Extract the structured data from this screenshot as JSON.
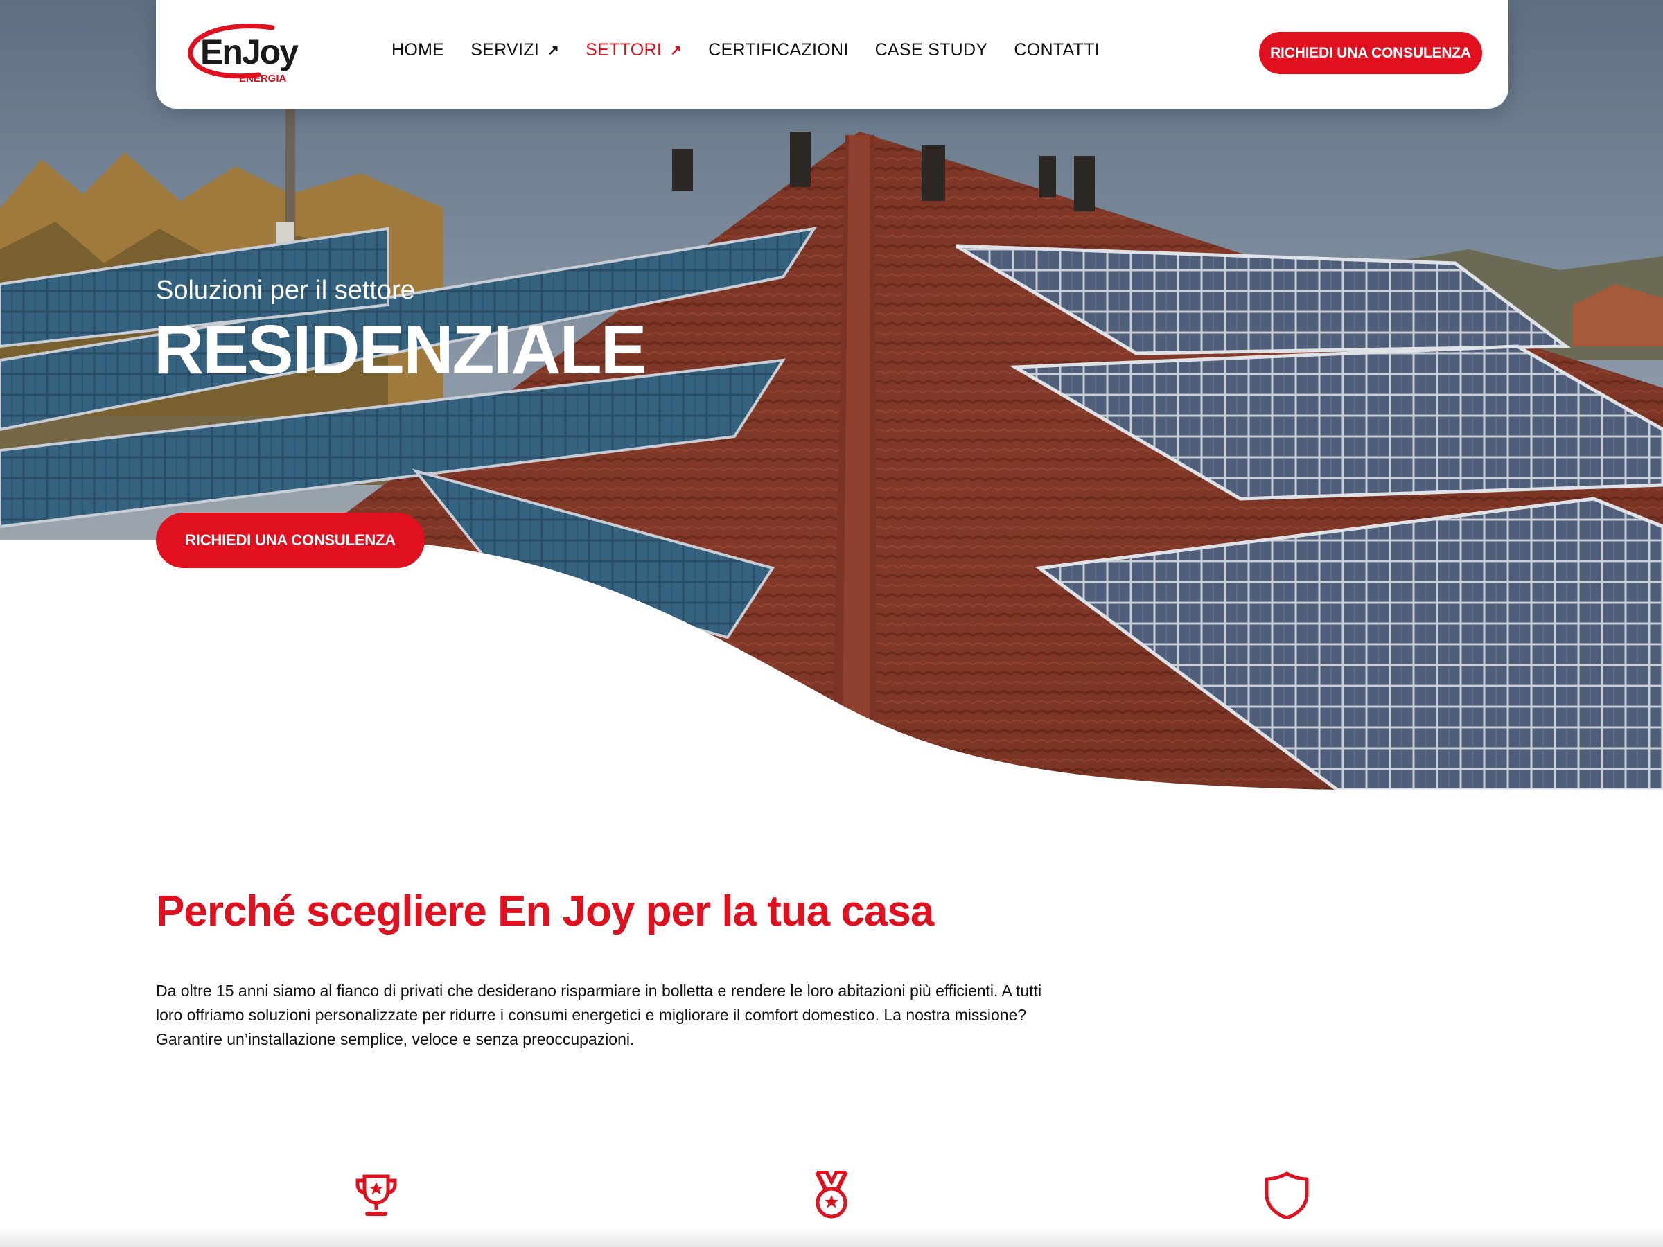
{
  "brand": {
    "logo_name": "EnJoy",
    "logo_sub": "ENERGIA",
    "accent_color": "#e0101f"
  },
  "nav": {
    "items": [
      {
        "label": "HOME",
        "has_arrow": false,
        "active": false
      },
      {
        "label": "SERVIZI",
        "has_arrow": true,
        "active": false
      },
      {
        "label": "SETTORI",
        "has_arrow": true,
        "active": true
      },
      {
        "label": "CERTIFICAZIONI",
        "has_arrow": false,
        "active": false
      },
      {
        "label": "CASE STUDY",
        "has_arrow": false,
        "active": false
      },
      {
        "label": "CONTATTI",
        "has_arrow": false,
        "active": false
      }
    ],
    "arrow_glyph": "↗",
    "cta_label": "RICHIEDI UNA CONSULENZA"
  },
  "hero": {
    "subtitle": "Soluzioni per il settore",
    "title": "RESIDENZIALE",
    "cta_label": "RICHIEDI UNA CONSULENZA"
  },
  "why": {
    "title": "Perché scegliere En Joy per la tua casa",
    "text": "Da oltre 15 anni siamo al fianco di privati che desiderano risparmiare in bolletta e rendere le loro abitazioni più efficienti. A tutti loro offriamo soluzioni personalizzate per ridurre i consumi energetici e migliorare il comfort domestico. La nostra missione? Garantire un’installazione semplice, veloce e senza preoccupazioni."
  },
  "features": [
    {
      "icon": "trophy-icon"
    },
    {
      "icon": "medal-icon"
    },
    {
      "icon": "shield-icon"
    }
  ]
}
